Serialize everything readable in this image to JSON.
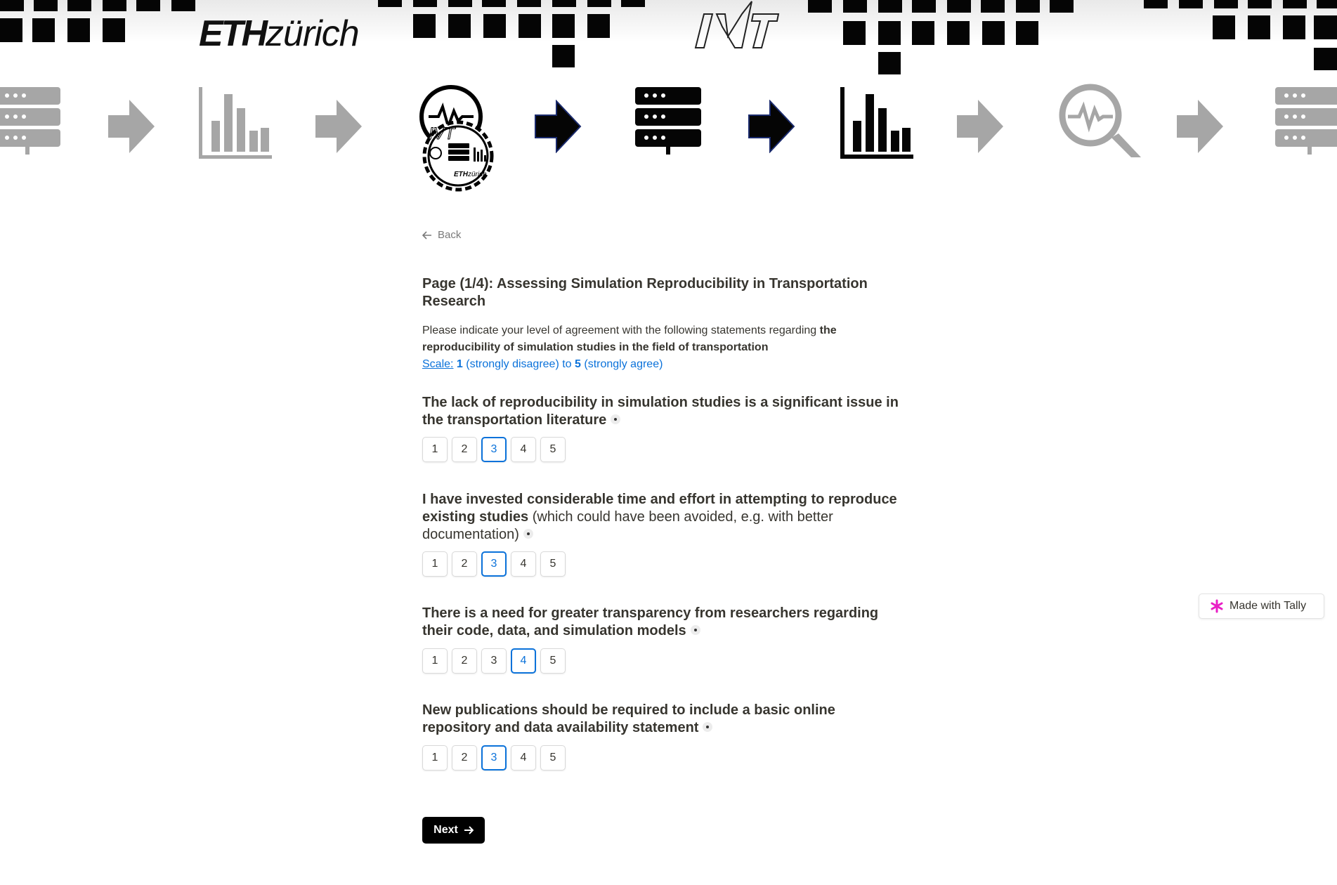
{
  "banner": {
    "eth_bold": "ETH",
    "eth_light": "zürich",
    "ivt_logo": "IVT",
    "icons": [
      "server-icon",
      "arrow-right-icon",
      "bar-chart-icon",
      "arrow-right-icon",
      "project-logo-icon",
      "arrow-right-icon",
      "server-icon",
      "arrow-right-icon",
      "bar-chart-icon",
      "arrow-right-icon",
      "analysis-magnifier-icon",
      "arrow-right-icon",
      "server-icon"
    ],
    "colors": {
      "dark": "#050505",
      "muted": "#a6a6a6",
      "arrow_outline": "#1a2a6c"
    }
  },
  "nav": {
    "back_label": "Back"
  },
  "page": {
    "title": "Page (1/4): Assessing Simulation Reproducibility in Transportation Research",
    "intro_text": "Please indicate your level of agreement with the following statements regarding ",
    "intro_bold": "the reproducibility of simulation studies in the field of transportation",
    "scale_label": "Scale:",
    "scale_min": "1",
    "scale_min_text": " (strongly disagree) to ",
    "scale_max": "5",
    "scale_max_text": " (strongly agree)"
  },
  "questions": [
    {
      "bold": "The lack of reproducibility in simulation studies is a significant issue in the transportation literature",
      "normal": "",
      "options": [
        "1",
        "2",
        "3",
        "4",
        "5"
      ],
      "selected": "3"
    },
    {
      "bold": "I have invested considerable time and effort in attempting to reproduce existing studies",
      "normal": " (which could have been avoided, e.g. with better documentation)",
      "options": [
        "1",
        "2",
        "3",
        "4",
        "5"
      ],
      "selected": "3"
    },
    {
      "bold": "There is a need for greater transparency from researchers regarding their code, data, and simulation models",
      "normal": "",
      "options": [
        "1",
        "2",
        "3",
        "4",
        "5"
      ],
      "selected": "4"
    },
    {
      "bold": "New publications should be required to include a basic online repository and data availability statement",
      "normal": "",
      "options": [
        "1",
        "2",
        "3",
        "4",
        "5"
      ],
      "selected": "3"
    }
  ],
  "footer": {
    "next_label": "Next"
  },
  "badge": {
    "label": "Made with Tally",
    "accent": "#e91ec5"
  },
  "theme": {
    "accent": "#0b72da",
    "text": "#37352f"
  }
}
